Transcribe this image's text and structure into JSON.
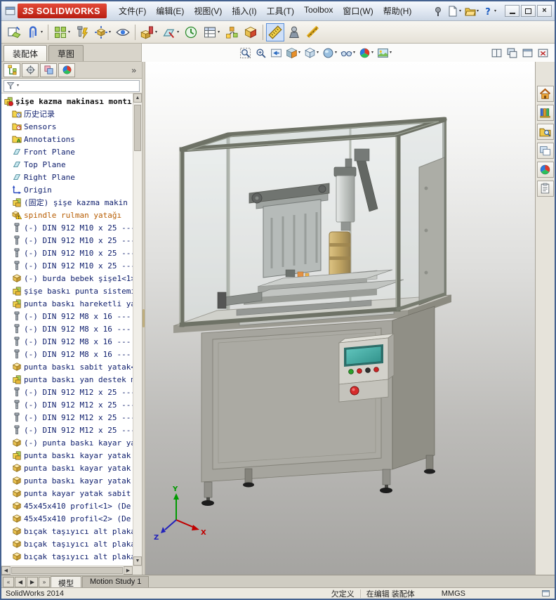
{
  "titlebar": {
    "logo_mark": "3S",
    "logo_word": "SOLIDWORKS",
    "menus": [
      "文件(F)",
      "编辑(E)",
      "视图(V)",
      "插入(I)",
      "工具(T)",
      "Toolbox",
      "窗口(W)",
      "帮助(H)"
    ],
    "quick_buttons": [
      {
        "name": "pin",
        "icon": "sym-pin"
      },
      {
        "name": "new-document",
        "icon": "sym-newdoc",
        "caret": true
      },
      {
        "name": "open-document",
        "icon": "sym-open",
        "caret": true
      },
      {
        "name": "help",
        "icon": "sym-help",
        "caret": true
      }
    ],
    "close_glyph": "×"
  },
  "glyphs": {
    "caret": "▾",
    "up": "▲",
    "down": "▼",
    "left": "◀",
    "right": "▶"
  },
  "toolbar": {
    "buttons": [
      {
        "name": "insert-components",
        "icon": "sym-insertcomp"
      },
      {
        "name": "mate",
        "icon": "sym-mate",
        "caret": true
      },
      {
        "sep": true
      },
      {
        "name": "linear-component-pattern",
        "icon": "sym-compattern",
        "caret": true
      },
      {
        "name": "smart-fasteners",
        "icon": "sym-fasteners"
      },
      {
        "name": "move-component",
        "icon": "sym-movecomp",
        "caret": true
      },
      {
        "name": "show-hidden-components",
        "icon": "sym-showhidden"
      },
      {
        "sep": true
      },
      {
        "name": "assembly-features",
        "icon": "sym-asmfeat",
        "caret": true
      },
      {
        "name": "reference-geometry",
        "icon": "sym-refgeo",
        "caret": true
      },
      {
        "name": "new-motion-study",
        "icon": "sym-motionstudy"
      },
      {
        "name": "bill-of-materials",
        "icon": "sym-bom",
        "caret": true
      },
      {
        "name": "exploded-view",
        "icon": "sym-explode"
      },
      {
        "name": "interference-detection",
        "icon": "sym-sectiontool"
      },
      {
        "sep": true
      },
      {
        "name": "measure",
        "icon": "sym-measure",
        "active": true
      },
      {
        "name": "mass-properties",
        "icon": "sym-massprops"
      },
      {
        "name": "instant-3d",
        "icon": "sym-instant3d"
      }
    ]
  },
  "command_tabs": {
    "assembly": "装配体",
    "sketch": "草图"
  },
  "headsup": {
    "buttons": [
      {
        "name": "zoom-to-fit",
        "icon": "sym-zoomfit"
      },
      {
        "name": "zoom-to-area",
        "icon": "sym-zoomarea"
      },
      {
        "name": "previous-view",
        "icon": "sym-prevview"
      },
      {
        "name": "section-view",
        "icon": "sym-section",
        "caret": true
      },
      {
        "name": "view-orientation",
        "icon": "sym-vieworient",
        "caret": true
      },
      {
        "name": "display-style",
        "icon": "sym-dispstyle",
        "caret": true
      },
      {
        "name": "hide-show-items",
        "icon": "sym-hideshow",
        "caret": true
      },
      {
        "name": "edit-appearance",
        "icon": "sym-ball",
        "caret": true
      },
      {
        "name": "apply-scene",
        "icon": "sym-scene",
        "caret": true
      }
    ],
    "far_buttons": [
      {
        "name": "tile-horizontal",
        "icon": "sym-winsplit"
      },
      {
        "name": "tile-vertical",
        "icon": "sym-wincasc"
      },
      {
        "name": "maximize-view",
        "icon": "sym-winframe"
      },
      {
        "name": "close-view",
        "icon": "sym-winx"
      }
    ]
  },
  "panel": {
    "tabs": [
      {
        "name": "featuremanager",
        "icon": "sym-ftree",
        "active": true
      },
      {
        "name": "propertymanager",
        "icon": "sym-propmgr"
      },
      {
        "name": "configurationmanager",
        "icon": "sym-cfgmgr"
      },
      {
        "name": "displaymanager",
        "icon": "sym-ball"
      }
    ],
    "overflow_glyph": "»",
    "filter_caret": "▾"
  },
  "tree": {
    "items": [
      {
        "label": "şişe kazma makinası montı",
        "icon": "asmtop",
        "indent": 0,
        "color": "#111111",
        "bold": true
      },
      {
        "label": "历史记录",
        "icon": "hist",
        "indent": 1
      },
      {
        "label": "Sensors",
        "icon": "sensors",
        "indent": 1
      },
      {
        "label": "Annotations",
        "icon": "annot",
        "indent": 1
      },
      {
        "label": "Front Plane",
        "icon": "plane",
        "indent": 1
      },
      {
        "label": "Top Plane",
        "icon": "plane",
        "indent": 1
      },
      {
        "label": "Right Plane",
        "icon": "plane",
        "indent": 1
      },
      {
        "label": "Origin",
        "icon": "origin",
        "indent": 1
      },
      {
        "label": "(固定) şişe kazma makin",
        "icon": "asm",
        "indent": 1
      },
      {
        "label": "spindle rulman yatağı",
        "icon": "warnpart",
        "indent": 1,
        "color": "#b75c00"
      },
      {
        "label": "(-) DIN 912 M10 x 25 ---",
        "icon": "screw",
        "indent": 1
      },
      {
        "label": "(-) DIN 912 M10 x 25 ---",
        "icon": "screw",
        "indent": 1
      },
      {
        "label": "(-) DIN 912 M10 x 25 ---",
        "icon": "screw",
        "indent": 1
      },
      {
        "label": "(-) DIN 912 M10 x 25 ---",
        "icon": "screw",
        "indent": 1
      },
      {
        "label": "(-) burda bebek şişe1<1>",
        "icon": "part",
        "indent": 1
      },
      {
        "label": "şişe baskı punta sistemi",
        "icon": "asm",
        "indent": 1
      },
      {
        "label": "punta baskı hareketli ya",
        "icon": "asm",
        "indent": 1
      },
      {
        "label": "(-) DIN 912 M8 x 16 ---",
        "icon": "screw",
        "indent": 1
      },
      {
        "label": "(-) DIN 912 M8 x 16 ---",
        "icon": "screw",
        "indent": 1
      },
      {
        "label": "(-) DIN 912 M8 x 16 ---",
        "icon": "screw",
        "indent": 1
      },
      {
        "label": "(-) DIN 912 M8 x 16 ---",
        "icon": "screw",
        "indent": 1
      },
      {
        "label": "punta baskı sabit yatak<",
        "icon": "part",
        "indent": 1
      },
      {
        "label": "punta baskı yan destek m",
        "icon": "asm",
        "indent": 1
      },
      {
        "label": "(-) DIN 912 M12 x 25 ---",
        "icon": "screw",
        "indent": 1
      },
      {
        "label": "(-) DIN 912 M12 x 25 ---",
        "icon": "screw",
        "indent": 1
      },
      {
        "label": "(-) DIN 912 M12 x 25 ---",
        "icon": "screw",
        "indent": 1
      },
      {
        "label": "(-) DIN 912 M12 x 25 ---",
        "icon": "screw",
        "indent": 1
      },
      {
        "label": "(-) punta baskı kayar ya",
        "icon": "part",
        "indent": 1
      },
      {
        "label": "punta baskı kayar yatak",
        "icon": "asm",
        "indent": 1
      },
      {
        "label": "punta baskı kayar yatak",
        "icon": "part",
        "indent": 1
      },
      {
        "label": "punta baskı kayar yatak",
        "icon": "part",
        "indent": 1
      },
      {
        "label": "punta kayar yatak sabit",
        "icon": "part",
        "indent": 1
      },
      {
        "label": "45x45x410 profil<1> (De",
        "icon": "part",
        "indent": 1
      },
      {
        "label": "45x45x410 profil<2> (De",
        "icon": "part",
        "indent": 1
      },
      {
        "label": "bıçak taşıyıcı alt plaka y",
        "icon": "part",
        "indent": 1
      },
      {
        "label": "bıçak taşıyıcı alt plaka y",
        "icon": "part",
        "indent": 1
      },
      {
        "label": "bıçak taşıyıcı alt plaka y",
        "icon": "part",
        "indent": 1
      }
    ]
  },
  "taskpane": {
    "buttons": [
      {
        "name": "solidworks-resources",
        "icon": "sym-home"
      },
      {
        "name": "design-library",
        "icon": "sym-designlib"
      },
      {
        "name": "file-explorer",
        "icon": "sym-fileexp"
      },
      {
        "name": "view-palette",
        "icon": "sym-viewpalette"
      },
      {
        "name": "appearances-scenes",
        "icon": "sym-ball"
      },
      {
        "name": "custom-properties",
        "icon": "sym-customprops"
      }
    ]
  },
  "bottom_tabs": {
    "nav": [
      "«",
      "◀",
      "▶",
      "»"
    ],
    "tabs": [
      {
        "label": "模型",
        "active": true
      },
      {
        "label": "Motion Study 1",
        "active": false
      }
    ]
  },
  "statusbar": {
    "app": "SolidWorks 2014",
    "state": "欠定义",
    "editing": "在编辑 装配体",
    "units": "MMGS"
  }
}
